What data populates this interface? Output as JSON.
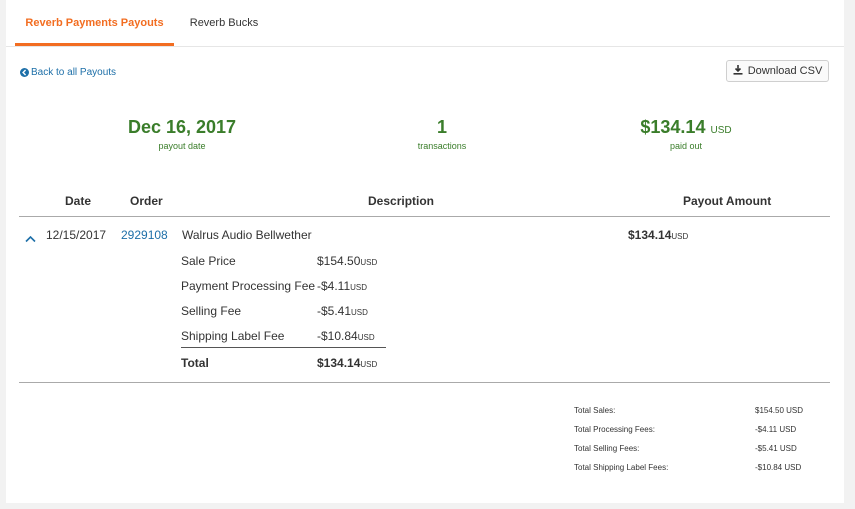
{
  "tabs": [
    {
      "label": "Reverb Payments Payouts",
      "active": true
    },
    {
      "label": "Reverb Bucks",
      "active": false
    }
  ],
  "back_link": "Back to all Payouts",
  "download_button": "Download CSV",
  "summary": {
    "date": {
      "value": "Dec 16, 2017",
      "label": "payout date"
    },
    "transactions": {
      "value": "1",
      "label": "transactions"
    },
    "paid": {
      "value": "$134.14",
      "unit": "USD",
      "label": "paid out"
    }
  },
  "table": {
    "headers": {
      "date": "Date",
      "order": "Order",
      "description": "Description",
      "amount": "Payout Amount"
    },
    "row": {
      "date": "12/15/2017",
      "order": "2929108",
      "description": "Walrus Audio Bellwether",
      "amount": "$134.14",
      "amount_unit": "USD"
    },
    "breakdown": [
      {
        "label": "Sale Price",
        "value": "$154.50",
        "unit": "USD"
      },
      {
        "label": "Payment Processing Fee",
        "value": "-$4.11",
        "unit": "USD"
      },
      {
        "label": "Selling Fee",
        "value": "-$5.41",
        "unit": "USD"
      },
      {
        "label": "Shipping Label Fee",
        "value": "-$10.84",
        "unit": "USD"
      },
      {
        "label": "Total",
        "value": "$134.14",
        "unit": "USD"
      }
    ]
  },
  "totals": [
    {
      "label": "Total Sales:",
      "value": "$154.50 USD"
    },
    {
      "label": "Total Processing Fees:",
      "value": "-$4.11 USD"
    },
    {
      "label": "Total Selling Fees:",
      "value": "-$5.41 USD"
    },
    {
      "label": "Total Shipping Label Fees:",
      "value": "-$10.84 USD"
    }
  ],
  "colors": {
    "accent": "#f26d21",
    "link": "#1d6fa8",
    "positive": "#3a7d2a"
  }
}
